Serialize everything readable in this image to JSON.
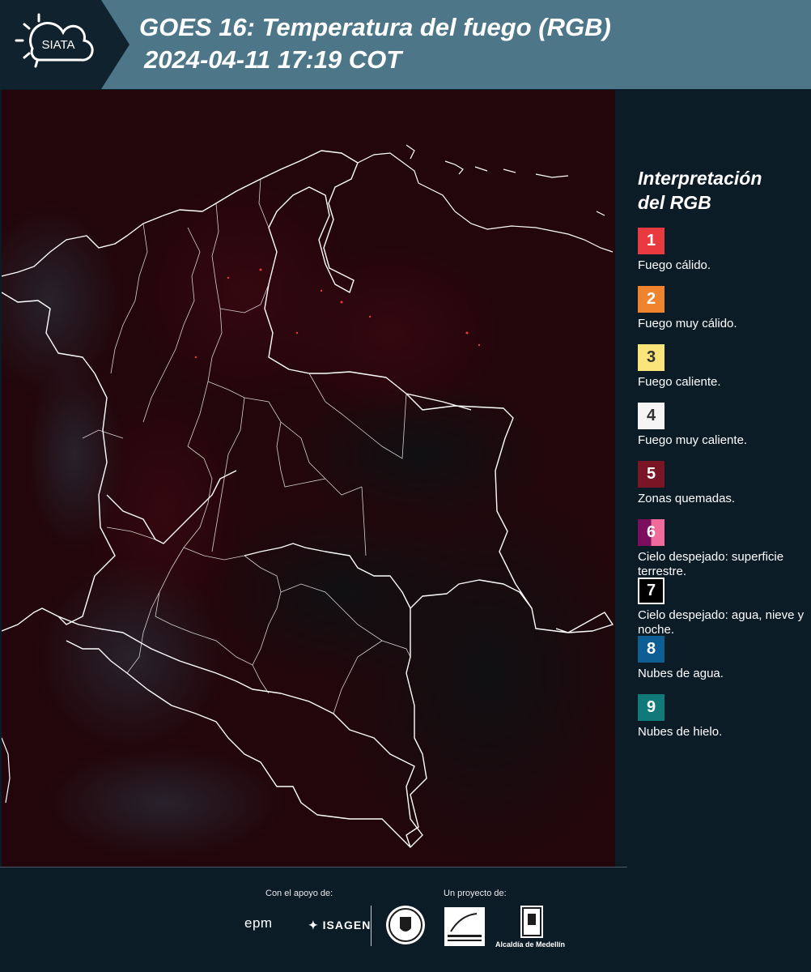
{
  "header": {
    "logo_text": "SIATA",
    "title_line1": "GOES 16: Temperatura del fuego (RGB)",
    "title_line2": "2024-04-11 17:19 COT",
    "background_color": "#4d7789"
  },
  "map": {
    "background_color": "#1e0509",
    "border_color": "#ffffff"
  },
  "legend": {
    "title_line1": "Interpretación",
    "title_line2": "del RGB",
    "items": [
      {
        "number": "1",
        "label": "Fuego cálido.",
        "color": "#e83a3f"
      },
      {
        "number": "2",
        "label": "Fuego muy cálido.",
        "color": "#f0832e"
      },
      {
        "number": "3",
        "label": "Fuego caliente.",
        "color": "#fae57a"
      },
      {
        "number": "4",
        "label": "Fuego muy caliente.",
        "color": "#f5f5f5"
      },
      {
        "number": "5",
        "label": "Zonas quemadas.",
        "color": "#7a1526"
      },
      {
        "number": "6",
        "label": "Cielo despejado: superficie terrestre.",
        "color": "#7b0f5e",
        "color2": "#f06a9a"
      },
      {
        "number": "7",
        "label": "Cielo despejado: agua, nieve y noche.",
        "color": "#000000"
      },
      {
        "number": "8",
        "label": "Nubes de agua.",
        "color": "#0f5e93"
      },
      {
        "number": "9",
        "label": "Nubes de hielo.",
        "color": "#0f7a78"
      }
    ]
  },
  "footer": {
    "support_label": "Con el apoyo de:",
    "project_label": "Un proyecto de:",
    "epm": "epm",
    "isagen": "ISAGEN",
    "alcaldia": "Alcaldía de Medellín"
  }
}
